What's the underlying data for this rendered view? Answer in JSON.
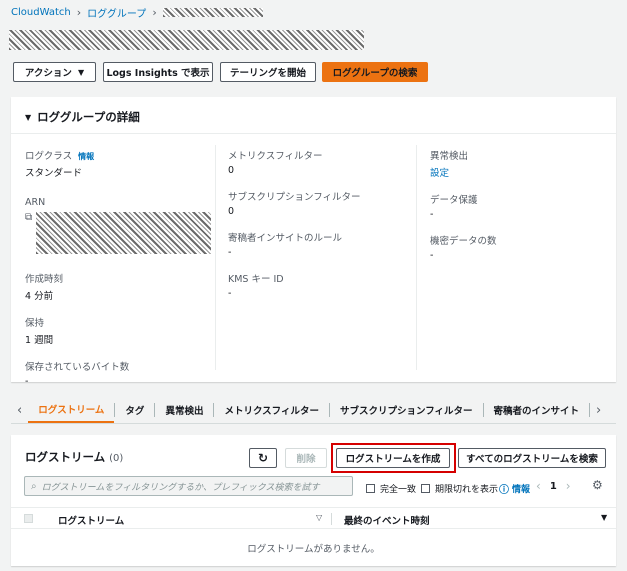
{
  "breadcrumb": {
    "root": "CloudWatch",
    "parent": "ロググループ"
  },
  "toolbar": {
    "actions_label": "アクション",
    "logs_insights_label": "Logs Insights で表示",
    "tailing_label": "テーリングを開始",
    "search_group_label": "ロググループの検索"
  },
  "details": {
    "title": "ロググループの詳細",
    "col1": {
      "log_class_label": "ログクラス",
      "log_class_info": "情報",
      "log_class_value": "スタンダード",
      "arn_label": "ARN",
      "created_label": "作成時刻",
      "created_value": "4 分前",
      "retention_label": "保持",
      "retention_value": "1 週間",
      "stored_bytes_label": "保存されているバイト数",
      "stored_bytes_value": "-"
    },
    "col2": {
      "metric_filter_label": "メトリクスフィルター",
      "metric_filter_value": "0",
      "subscription_label": "サブスクリプションフィルター",
      "subscription_value": "0",
      "contributor_label": "寄稿者インサイトのルール",
      "contributor_value": "-",
      "kms_label": "KMS キー ID",
      "kms_value": "-"
    },
    "col3": {
      "anomaly_label": "異常検出",
      "anomaly_value": "設定",
      "data_protection_label": "データ保護",
      "data_protection_value": "-",
      "sensitive_label": "機密データの数",
      "sensitive_value": "-"
    }
  },
  "tabs": [
    {
      "label": "ログストリーム"
    },
    {
      "label": "タグ"
    },
    {
      "label": "異常検出"
    },
    {
      "label": "メトリクスフィルター"
    },
    {
      "label": "サブスクリプションフィルター"
    },
    {
      "label": "寄稿者のインサイト"
    }
  ],
  "streams": {
    "title": "ログストリーム",
    "count": "(0)",
    "delete_label": "削除",
    "create_label": "ログストリームを作成",
    "search_all_label": "すべてのログストリームを検索",
    "filter_placeholder": "ログストリームをフィルタリングするか、プレフィックス検索を試す",
    "exact_match_label": "完全一致",
    "expired_label": "期限切れを表示",
    "info_label": "情報",
    "page_number": "1",
    "col_stream": "ログストリーム",
    "col_last_event": "最終のイベント時刻",
    "empty_text": "ログストリームがありません。"
  },
  "colors": {
    "accent": "#ec7211",
    "link": "#0073bb",
    "highlight": "#d50000"
  }
}
